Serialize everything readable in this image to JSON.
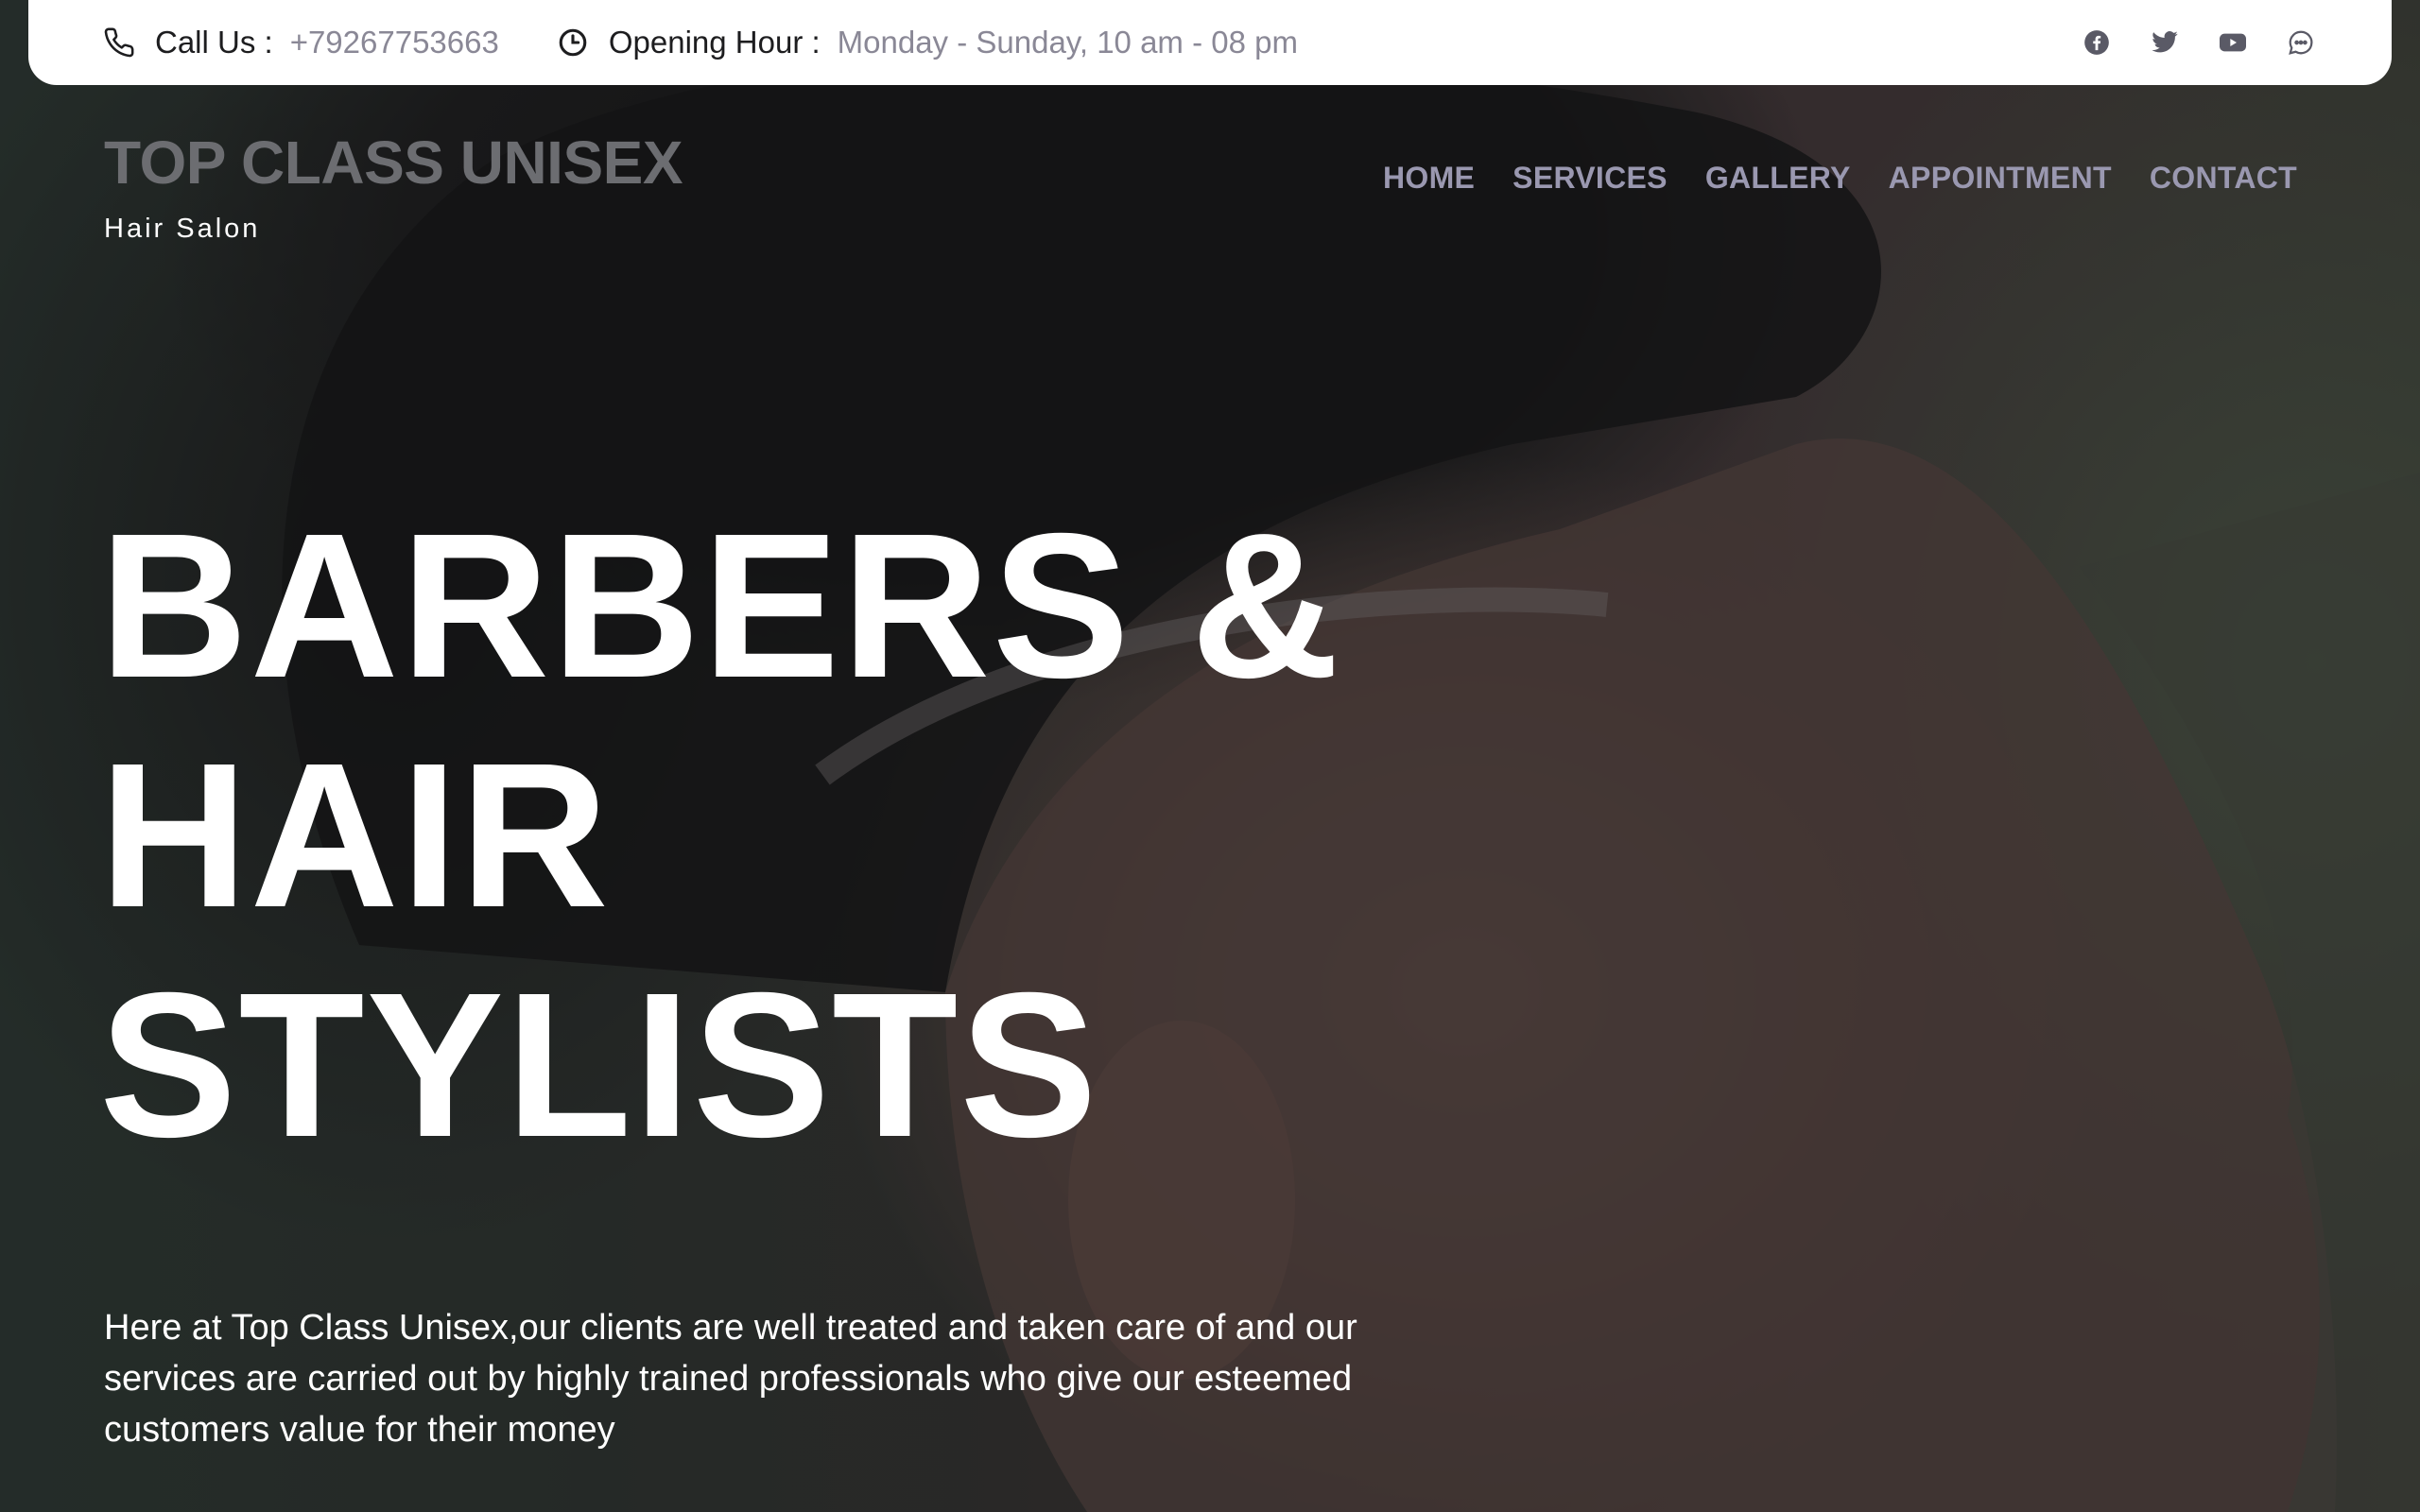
{
  "topbar": {
    "call_label": "Call Us :",
    "call_value": "+79267753663",
    "hours_label": "Opening Hour :",
    "hours_value": "Monday - Sunday, 10 am - 08 pm",
    "icons": [
      "phone-icon",
      "clock-icon"
    ],
    "social": [
      "facebook-icon",
      "twitter-icon",
      "youtube-icon",
      "chat-icon"
    ]
  },
  "brand": {
    "title": "TOP CLASS UNISEX",
    "subtitle": "Hair Salon"
  },
  "nav": [
    "HOME",
    "SERVICES",
    "GALLERY",
    "APPOINTMENT",
    "CONTACT"
  ],
  "hero": {
    "title_lines": [
      "BARBERS &",
      "HAIR",
      "STYLISTS"
    ],
    "description": "Here at Top Class Unisex,our clients are well treated and taken care of and our services are carried out by highly trained professionals who give our esteemed customers value for their money"
  },
  "colors": {
    "topbar_bg": "#ffffff",
    "muted_text": "#8a8896",
    "nav_text": "#9a98b0",
    "brand_text": "#6c6d71",
    "hero_text": "#ffffff"
  }
}
